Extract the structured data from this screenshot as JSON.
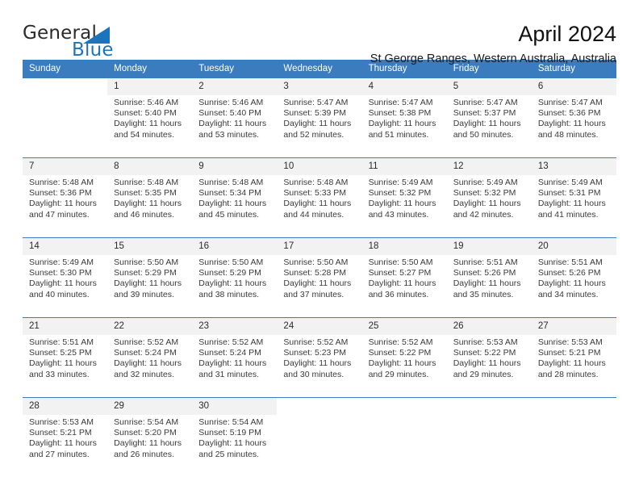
{
  "brand": {
    "name_part1": "General",
    "name_part2": "Blue",
    "flag_icon": "triangle-flag-icon"
  },
  "header": {
    "title": "April 2024",
    "subtitle": "St George Ranges, Western Australia, Australia"
  },
  "colors": {
    "header_blue": "#3a7cbe",
    "brand_blue": "#1c74bc",
    "daynum_band": "#f2f2f2",
    "body_bg": "#ffffff",
    "text": "#3a3a3a"
  },
  "calendar": {
    "weekday_headers": [
      "Sunday",
      "Monday",
      "Tuesday",
      "Wednesday",
      "Thursday",
      "Friday",
      "Saturday"
    ],
    "weeks": [
      [
        {
          "day": "",
          "lines": []
        },
        {
          "day": "1",
          "lines": [
            "Sunrise: 5:46 AM",
            "Sunset: 5:40 PM",
            "Daylight: 11 hours",
            "and 54 minutes."
          ]
        },
        {
          "day": "2",
          "lines": [
            "Sunrise: 5:46 AM",
            "Sunset: 5:40 PM",
            "Daylight: 11 hours",
            "and 53 minutes."
          ]
        },
        {
          "day": "3",
          "lines": [
            "Sunrise: 5:47 AM",
            "Sunset: 5:39 PM",
            "Daylight: 11 hours",
            "and 52 minutes."
          ]
        },
        {
          "day": "4",
          "lines": [
            "Sunrise: 5:47 AM",
            "Sunset: 5:38 PM",
            "Daylight: 11 hours",
            "and 51 minutes."
          ]
        },
        {
          "day": "5",
          "lines": [
            "Sunrise: 5:47 AM",
            "Sunset: 5:37 PM",
            "Daylight: 11 hours",
            "and 50 minutes."
          ]
        },
        {
          "day": "6",
          "lines": [
            "Sunrise: 5:47 AM",
            "Sunset: 5:36 PM",
            "Daylight: 11 hours",
            "and 48 minutes."
          ]
        }
      ],
      [
        {
          "day": "7",
          "lines": [
            "Sunrise: 5:48 AM",
            "Sunset: 5:36 PM",
            "Daylight: 11 hours",
            "and 47 minutes."
          ]
        },
        {
          "day": "8",
          "lines": [
            "Sunrise: 5:48 AM",
            "Sunset: 5:35 PM",
            "Daylight: 11 hours",
            "and 46 minutes."
          ]
        },
        {
          "day": "9",
          "lines": [
            "Sunrise: 5:48 AM",
            "Sunset: 5:34 PM",
            "Daylight: 11 hours",
            "and 45 minutes."
          ]
        },
        {
          "day": "10",
          "lines": [
            "Sunrise: 5:48 AM",
            "Sunset: 5:33 PM",
            "Daylight: 11 hours",
            "and 44 minutes."
          ]
        },
        {
          "day": "11",
          "lines": [
            "Sunrise: 5:49 AM",
            "Sunset: 5:32 PM",
            "Daylight: 11 hours",
            "and 43 minutes."
          ]
        },
        {
          "day": "12",
          "lines": [
            "Sunrise: 5:49 AM",
            "Sunset: 5:32 PM",
            "Daylight: 11 hours",
            "and 42 minutes."
          ]
        },
        {
          "day": "13",
          "lines": [
            "Sunrise: 5:49 AM",
            "Sunset: 5:31 PM",
            "Daylight: 11 hours",
            "and 41 minutes."
          ]
        }
      ],
      [
        {
          "day": "14",
          "lines": [
            "Sunrise: 5:49 AM",
            "Sunset: 5:30 PM",
            "Daylight: 11 hours",
            "and 40 minutes."
          ]
        },
        {
          "day": "15",
          "lines": [
            "Sunrise: 5:50 AM",
            "Sunset: 5:29 PM",
            "Daylight: 11 hours",
            "and 39 minutes."
          ]
        },
        {
          "day": "16",
          "lines": [
            "Sunrise: 5:50 AM",
            "Sunset: 5:29 PM",
            "Daylight: 11 hours",
            "and 38 minutes."
          ]
        },
        {
          "day": "17",
          "lines": [
            "Sunrise: 5:50 AM",
            "Sunset: 5:28 PM",
            "Daylight: 11 hours",
            "and 37 minutes."
          ]
        },
        {
          "day": "18",
          "lines": [
            "Sunrise: 5:50 AM",
            "Sunset: 5:27 PM",
            "Daylight: 11 hours",
            "and 36 minutes."
          ]
        },
        {
          "day": "19",
          "lines": [
            "Sunrise: 5:51 AM",
            "Sunset: 5:26 PM",
            "Daylight: 11 hours",
            "and 35 minutes."
          ]
        },
        {
          "day": "20",
          "lines": [
            "Sunrise: 5:51 AM",
            "Sunset: 5:26 PM",
            "Daylight: 11 hours",
            "and 34 minutes."
          ]
        }
      ],
      [
        {
          "day": "21",
          "lines": [
            "Sunrise: 5:51 AM",
            "Sunset: 5:25 PM",
            "Daylight: 11 hours",
            "and 33 minutes."
          ]
        },
        {
          "day": "22",
          "lines": [
            "Sunrise: 5:52 AM",
            "Sunset: 5:24 PM",
            "Daylight: 11 hours",
            "and 32 minutes."
          ]
        },
        {
          "day": "23",
          "lines": [
            "Sunrise: 5:52 AM",
            "Sunset: 5:24 PM",
            "Daylight: 11 hours",
            "and 31 minutes."
          ]
        },
        {
          "day": "24",
          "lines": [
            "Sunrise: 5:52 AM",
            "Sunset: 5:23 PM",
            "Daylight: 11 hours",
            "and 30 minutes."
          ]
        },
        {
          "day": "25",
          "lines": [
            "Sunrise: 5:52 AM",
            "Sunset: 5:22 PM",
            "Daylight: 11 hours",
            "and 29 minutes."
          ]
        },
        {
          "day": "26",
          "lines": [
            "Sunrise: 5:53 AM",
            "Sunset: 5:22 PM",
            "Daylight: 11 hours",
            "and 29 minutes."
          ]
        },
        {
          "day": "27",
          "lines": [
            "Sunrise: 5:53 AM",
            "Sunset: 5:21 PM",
            "Daylight: 11 hours",
            "and 28 minutes."
          ]
        }
      ],
      [
        {
          "day": "28",
          "lines": [
            "Sunrise: 5:53 AM",
            "Sunset: 5:21 PM",
            "Daylight: 11 hours",
            "and 27 minutes."
          ]
        },
        {
          "day": "29",
          "lines": [
            "Sunrise: 5:54 AM",
            "Sunset: 5:20 PM",
            "Daylight: 11 hours",
            "and 26 minutes."
          ]
        },
        {
          "day": "30",
          "lines": [
            "Sunrise: 5:54 AM",
            "Sunset: 5:19 PM",
            "Daylight: 11 hours",
            "and 25 minutes."
          ]
        },
        {
          "day": "",
          "lines": []
        },
        {
          "day": "",
          "lines": []
        },
        {
          "day": "",
          "lines": []
        },
        {
          "day": "",
          "lines": []
        }
      ]
    ]
  }
}
